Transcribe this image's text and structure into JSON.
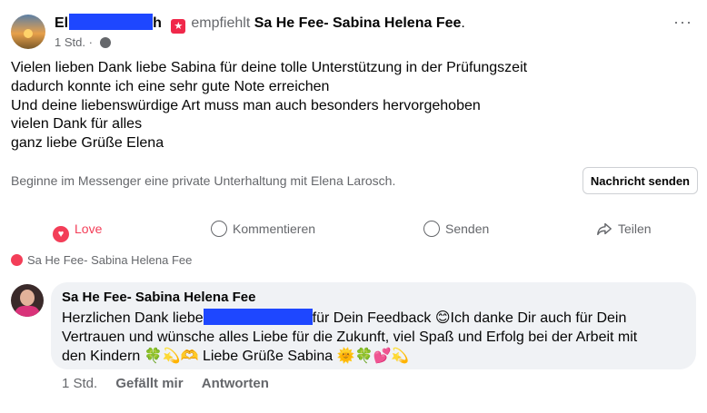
{
  "post": {
    "author_visible": "El",
    "author_tail": "h",
    "recommends": "empfiehlt",
    "page_name": "Sa He Fee- Sabina Helena Fee",
    "page_name_suffix": ".",
    "time": "1 Std. ·",
    "more_label": "···",
    "body_lines": [
      "Vielen lieben Dank liebe Sabina für deine tolle Unterstützung in der Prüfungszeit",
      "dadurch konnte ich eine sehr gute Note erreichen",
      "Und deine liebenswürdige Art muss man auch besonders hervorgehoben",
      "vielen Dank für alles",
      "ganz liebe Grüße Elena"
    ]
  },
  "messenger": {
    "prompt": "Beginne im Messenger eine private Unterhaltung mit Elena Larosch.",
    "button": "Nachricht senden"
  },
  "actions": {
    "love": "Love",
    "comment": "Kommentieren",
    "send": "Senden",
    "share": "Teilen"
  },
  "reaction": {
    "by": "Sa He Fee- Sabina Helena Fee"
  },
  "comment": {
    "author": "Sa He Fee- Sabina Helena Fee",
    "line1_before": "Herzlichen Dank liebe",
    "line1_after": "für Dein Feedback 😊Ich danke Dir auch für Dein",
    "line2": "Vertrauen und wünsche alles Liebe für die Zukunft, viel Spaß und Erfolg bei der Arbeit mit",
    "line3": "den Kindern 🍀💫🫶 Liebe Grüße Sabina 🌞🍀💕💫",
    "time": "1 Std.",
    "like": "Gefällt mir",
    "reply": "Antworten"
  },
  "colors": {
    "love_red": "#f33e58",
    "redaction_blue": "#1e47ff",
    "secondary_text": "#65676b",
    "bubble_bg": "#f0f2f5"
  }
}
